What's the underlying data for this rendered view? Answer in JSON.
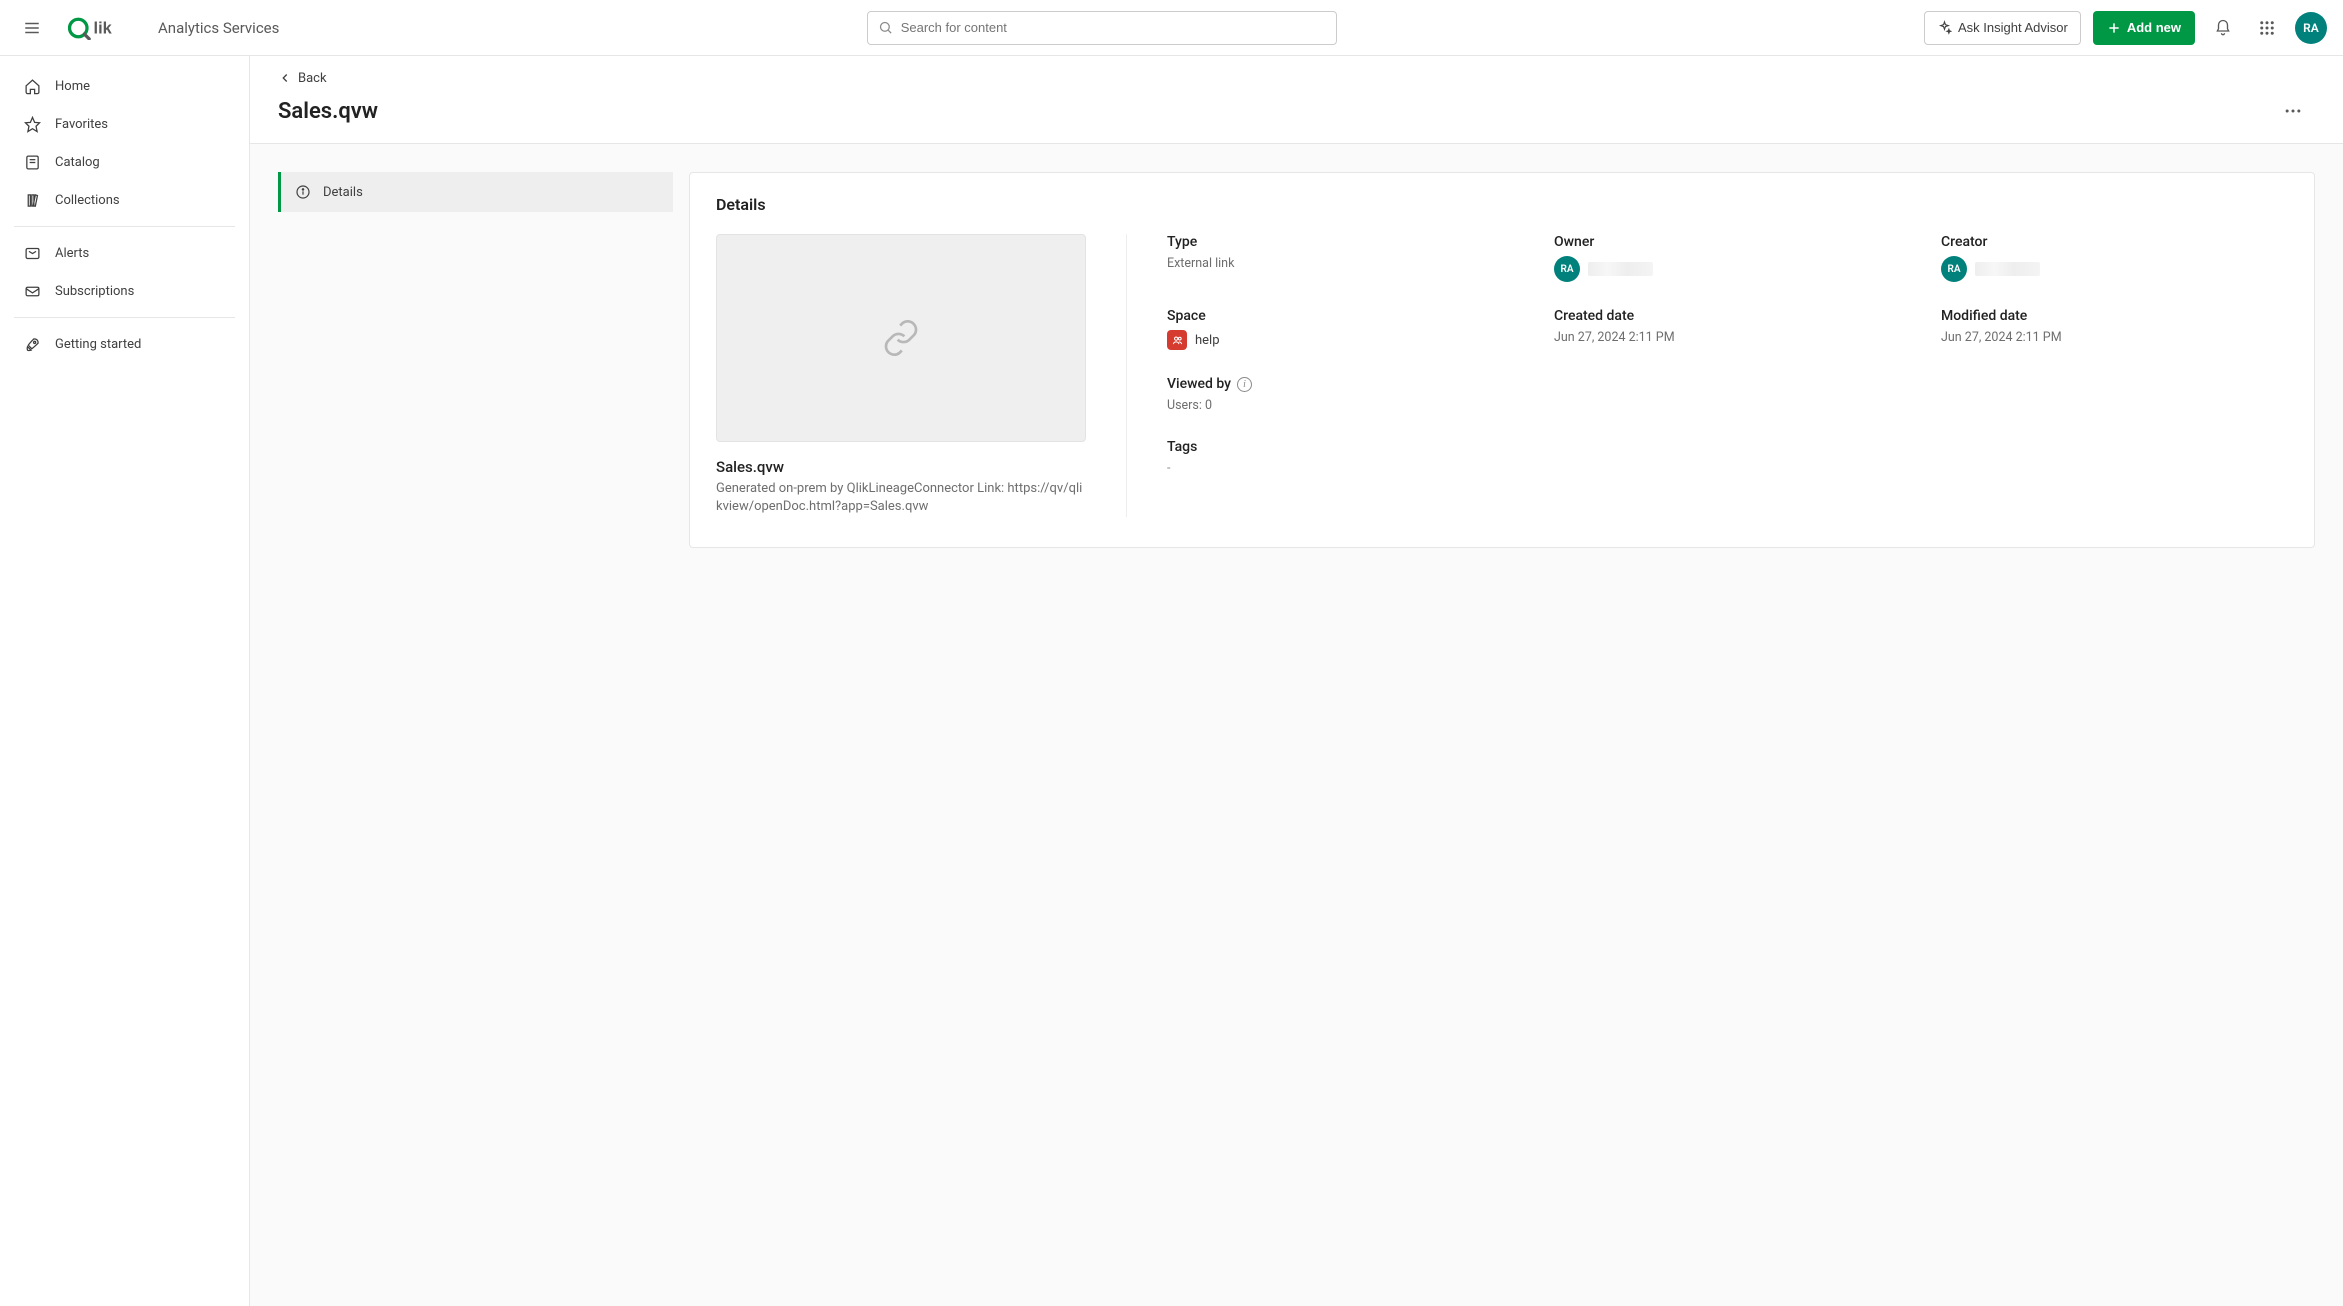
{
  "header": {
    "workspace": "Analytics Services",
    "search_placeholder": "Search for content",
    "ask_label": "Ask Insight Advisor",
    "addnew_label": "Add new",
    "avatar_initials": "RA"
  },
  "sidebar": {
    "items": [
      {
        "id": "home",
        "label": "Home"
      },
      {
        "id": "favorites",
        "label": "Favorites"
      },
      {
        "id": "catalog",
        "label": "Catalog"
      },
      {
        "id": "collections",
        "label": "Collections"
      }
    ],
    "items2": [
      {
        "id": "alerts",
        "label": "Alerts"
      },
      {
        "id": "subscriptions",
        "label": "Subscriptions"
      }
    ],
    "items3": [
      {
        "id": "getstarted",
        "label": "Getting started"
      }
    ]
  },
  "page": {
    "back_label": "Back",
    "title": "Sales.qvw"
  },
  "tabs": {
    "details": "Details"
  },
  "details": {
    "heading": "Details",
    "file_name": "Sales.qvw",
    "file_desc": "Generated on-prem by QlikLineageConnector Link: https://qv/qlikview/openDoc.html?app=Sales.qvw",
    "labels": {
      "type": "Type",
      "owner": "Owner",
      "creator": "Creator",
      "space": "Space",
      "created": "Created date",
      "modified": "Modified date",
      "viewed": "Viewed by",
      "tags": "Tags"
    },
    "type_value": "External link",
    "space_value": "help",
    "created_value": "Jun 27, 2024 2:11 PM",
    "modified_value": "Jun 27, 2024 2:11 PM",
    "viewed_value": "Users: 0",
    "tags_value": "-",
    "owner_initials": "RA",
    "creator_initials": "RA"
  }
}
